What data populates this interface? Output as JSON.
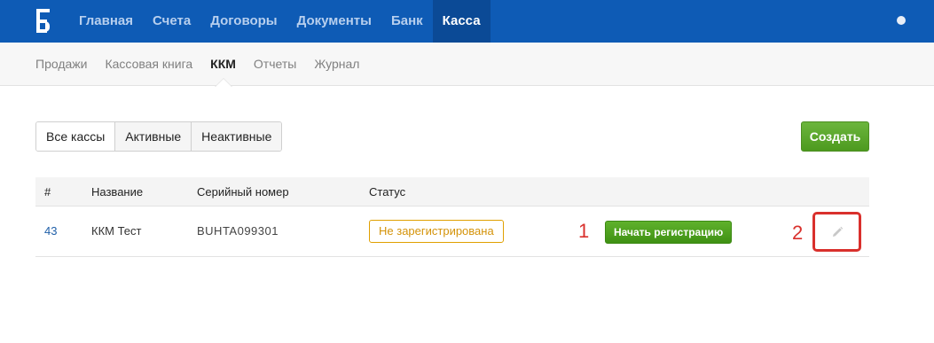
{
  "header": {
    "logo_icon": "bank-b-logo",
    "nav": [
      {
        "label": "Главная",
        "active": false
      },
      {
        "label": "Счета",
        "active": false
      },
      {
        "label": "Договоры",
        "active": false
      },
      {
        "label": "Документы",
        "active": false
      },
      {
        "label": "Банк",
        "active": false
      },
      {
        "label": "Касса",
        "active": true
      }
    ],
    "user_icon": "user-status-dot"
  },
  "subnav": {
    "tabs": [
      {
        "label": "Продажи",
        "active": false
      },
      {
        "label": "Кассовая книга",
        "active": false
      },
      {
        "label": "ККМ",
        "active": true
      },
      {
        "label": "Отчеты",
        "active": false
      },
      {
        "label": "Журнал",
        "active": false
      }
    ]
  },
  "filters": {
    "items": [
      {
        "label": "Все кассы",
        "selected": true
      },
      {
        "label": "Активные",
        "selected": false
      },
      {
        "label": "Неактивные",
        "selected": false
      }
    ]
  },
  "actions": {
    "create_label": "Создать"
  },
  "table": {
    "columns": [
      "#",
      "Название",
      "Серийный номер",
      "Статус"
    ],
    "rows": [
      {
        "id": "43",
        "name": "ККМ Тест",
        "serial": "BUHTA099301",
        "status": "Не зарегистрирована",
        "action_label": "Начать регистрацию",
        "edit_icon": "pencil-icon"
      }
    ]
  },
  "annotations": {
    "marker_1": "1",
    "marker_2": "2"
  },
  "colors": {
    "header_bg": "#0e5bb5",
    "header_active_bg": "#0b4a96",
    "accent_green": "#4d9a1f",
    "status_warning": "#e0a000",
    "annotation_red": "#d9302c",
    "link_blue": "#1f5fa8"
  }
}
